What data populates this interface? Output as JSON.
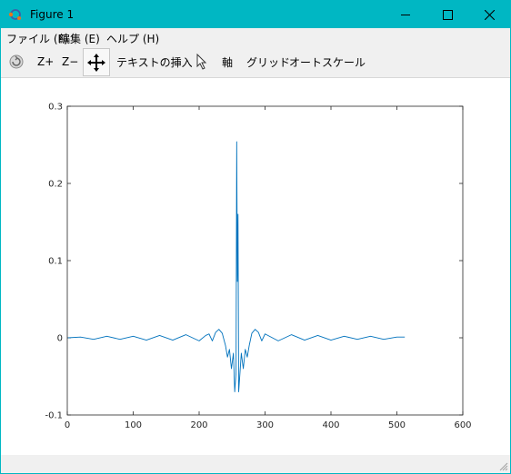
{
  "window": {
    "title": "Figure 1",
    "controls": [
      "minimize",
      "maximize",
      "close"
    ]
  },
  "menubar": {
    "items": [
      "ファイル (F)",
      "編集 (E)",
      "ヘルプ (H)"
    ]
  },
  "toolbar": {
    "zoom_in": "Z+",
    "zoom_out": "Z−",
    "insert_text": "テキストの挿入",
    "axes": "軸",
    "grid": "グリッド",
    "autoscale": "オートスケール",
    "icons": [
      "rotate-icon",
      "pan-icon",
      "select-arrow-icon"
    ]
  },
  "chart_data": {
    "type": "line",
    "title": "",
    "xlabel": "",
    "ylabel": "",
    "xlim": [
      0,
      600
    ],
    "ylim": [
      -0.1,
      0.3
    ],
    "xticks": [
      0,
      100,
      200,
      300,
      400,
      500,
      600
    ],
    "yticks": [
      -0.1,
      0,
      0.1,
      0.2,
      0.3
    ],
    "xtick_labels": [
      "0",
      "100",
      "200",
      "300",
      "400",
      "500",
      "600"
    ],
    "ytick_labels": [
      "-0.1",
      "0",
      "0.1",
      "0.2",
      "0.3"
    ],
    "grid": false,
    "series_color": "#0072bd",
    "series": [
      {
        "x": [
          1,
          20,
          40,
          60,
          80,
          100,
          120,
          140,
          160,
          180,
          200,
          210,
          215,
          220,
          225,
          230,
          235,
          240,
          243,
          246,
          249,
          252,
          254,
          256,
          257,
          258,
          259,
          260,
          262,
          264,
          267,
          270,
          273,
          276,
          280,
          285,
          290,
          295,
          300,
          320,
          340,
          360,
          380,
          400,
          420,
          440,
          460,
          480,
          500,
          512
        ],
        "y": [
          0,
          0.001,
          -0.002,
          0.002,
          -0.002,
          0.002,
          -0.003,
          0.003,
          -0.003,
          0.004,
          -0.004,
          0.003,
          0.005,
          -0.004,
          0.007,
          0.011,
          0.006,
          -0.01,
          -0.025,
          -0.015,
          -0.04,
          -0.02,
          -0.07,
          -0.045,
          0.254,
          0.073,
          0.16,
          -0.07,
          -0.045,
          -0.02,
          -0.04,
          -0.015,
          -0.025,
          -0.01,
          0.006,
          0.011,
          0.007,
          -0.004,
          0.005,
          -0.004,
          0.004,
          -0.003,
          0.003,
          -0.003,
          0.002,
          -0.002,
          0.002,
          -0.002,
          0.001,
          0.001
        ]
      }
    ]
  }
}
